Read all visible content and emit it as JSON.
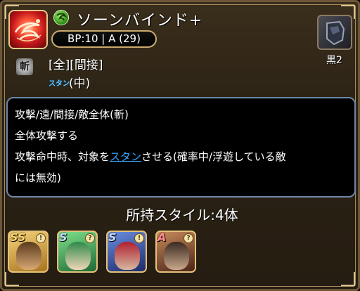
{
  "skill": {
    "name": "ソーンバインド+",
    "bp_info": "BP:10 | A (29)",
    "target": "[全][間接]",
    "stun_badge": "スタン",
    "stun_level": "(中)",
    "attack_type_glyph": "斬"
  },
  "weapon": {
    "label": "黒2"
  },
  "description": {
    "line1": "攻撃/遠/間接/敵全体(斬)",
    "line2": "全体攻撃する",
    "line3_pre": "攻撃命中時、対象を",
    "line3_link": "スタン",
    "line3_post": "させる(確率中/浮遊している敵",
    "line4": "には無効)"
  },
  "styles": {
    "title": "所持スタイル:4体",
    "items": [
      {
        "rank": "SS",
        "info": "!",
        "color": "#e6b23a"
      },
      {
        "rank": "S",
        "info": "?",
        "color": "#3aa35a"
      },
      {
        "rank": "S",
        "info": "!",
        "color": "#2a4fae"
      },
      {
        "rank": "A",
        "info": "?",
        "color": "#8a3a2a"
      }
    ]
  },
  "colors": {
    "stun": "#3aa6ff",
    "frame": "#c9ab6e"
  }
}
